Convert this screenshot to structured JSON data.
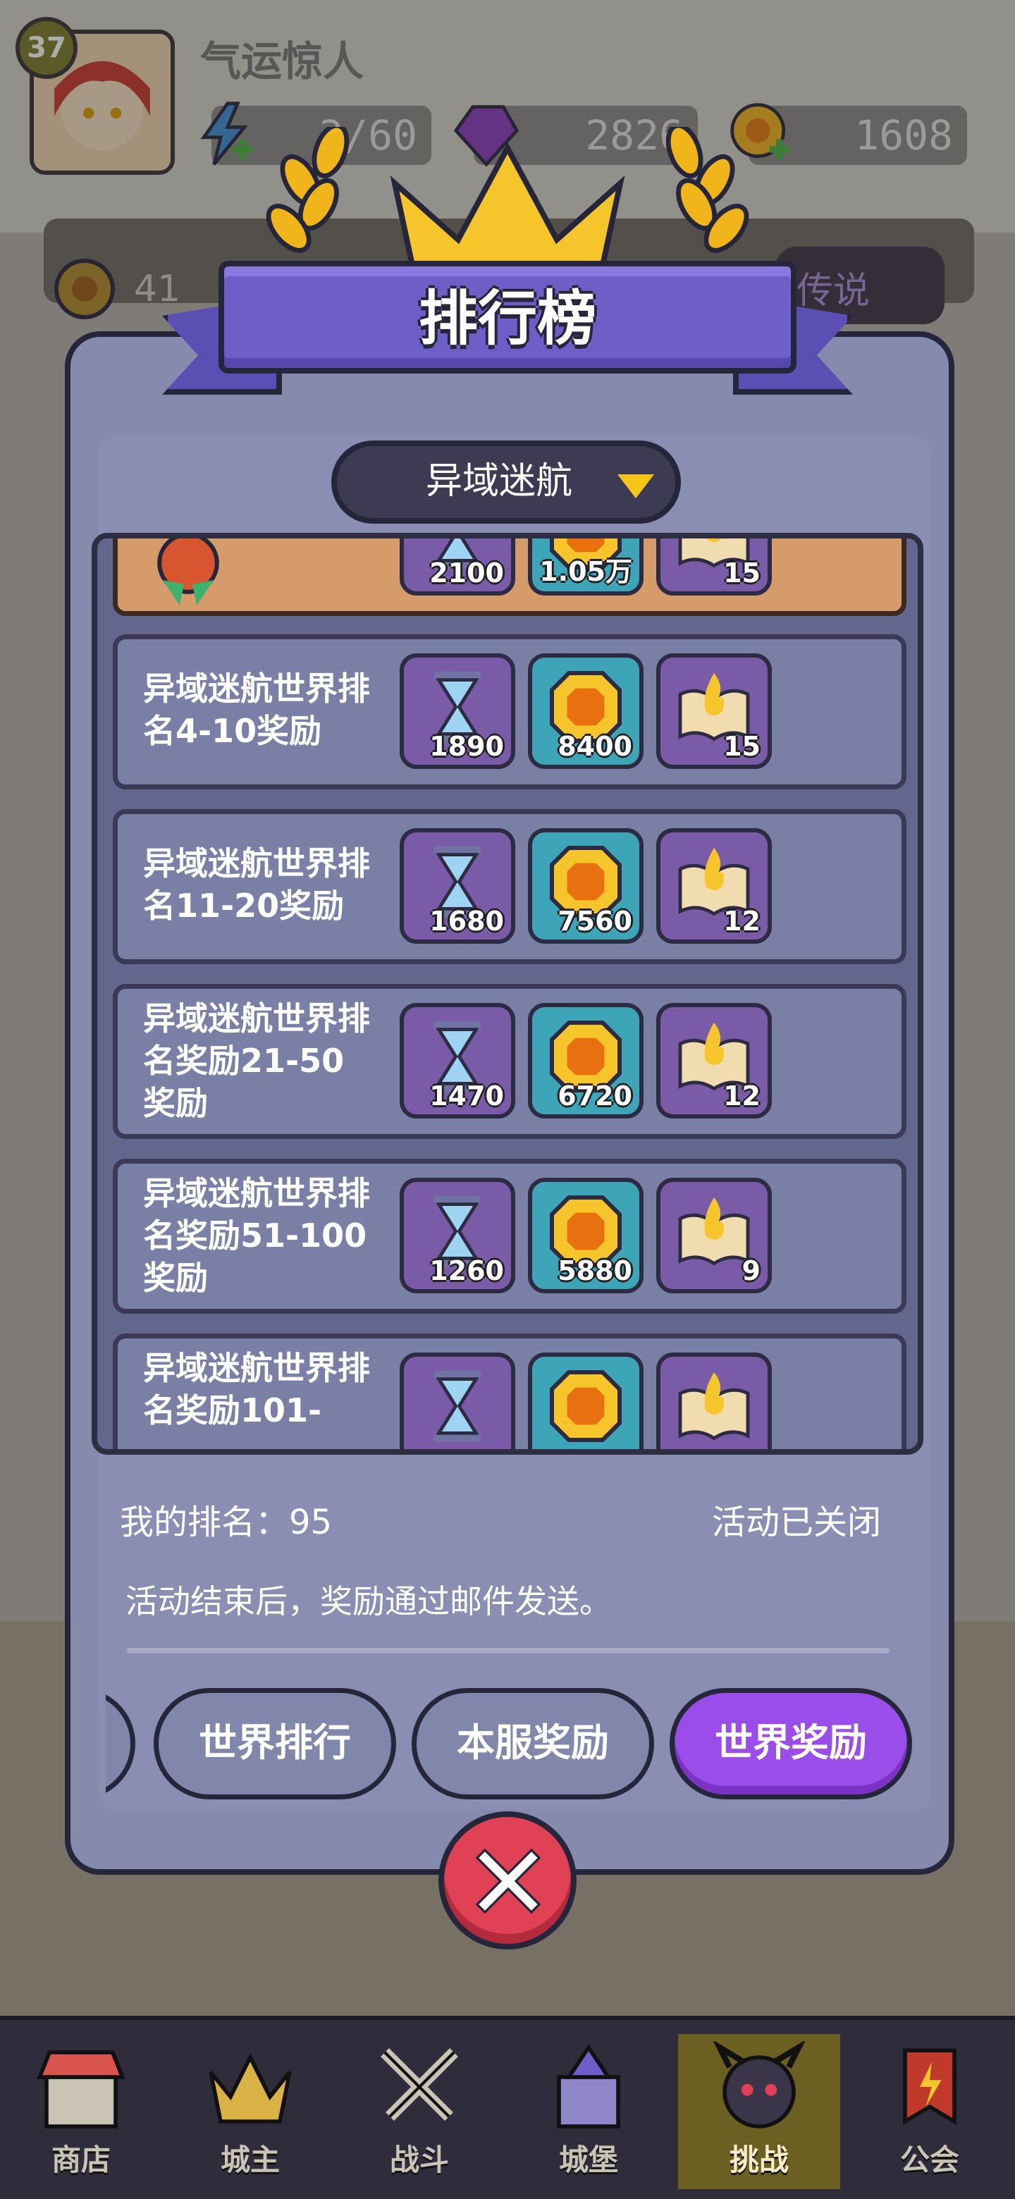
{
  "player": {
    "level": "37",
    "name": "气运惊人"
  },
  "resources": {
    "energy": "3/60",
    "gems": "2826",
    "coins": "1608"
  },
  "background": {
    "partial_amount": "41",
    "side_dropdown": "传说"
  },
  "panel": {
    "title": "排行榜",
    "selected_event": "异域迷航"
  },
  "reward_rows": [
    {
      "label": "",
      "items": [
        "2100",
        "1.05万",
        "15"
      ]
    },
    {
      "label": "异域迷航世界排名4-10奖励",
      "items": [
        "1890",
        "8400",
        "15"
      ]
    },
    {
      "label": "异域迷航世界排名11-20奖励",
      "items": [
        "1680",
        "7560",
        "12"
      ]
    },
    {
      "label": "异域迷航世界排名奖励21-50奖励",
      "items": [
        "1470",
        "6720",
        "12"
      ]
    },
    {
      "label": "异域迷航世界排名奖励51-100奖励",
      "items": [
        "1260",
        "5880",
        "9"
      ]
    },
    {
      "label": "异域迷航世界排名奖励101-",
      "items": [
        "",
        "",
        ""
      ]
    }
  ],
  "info": {
    "my_rank_label": "我的排名：95",
    "status": "活动已关闭",
    "note": "活动结束后，奖励通过邮件发送。"
  },
  "tabs": [
    "世界排行",
    "本服奖励",
    "世界奖励"
  ],
  "active_tab": "世界奖励",
  "nav": [
    "商店",
    "城主",
    "战斗",
    "城堡",
    "挑战",
    "公会"
  ],
  "active_nav": "挑战",
  "colors": {
    "panel": "#868bae",
    "active_tab": "#9a4de8",
    "close": "#e04155",
    "banner": "#6e5ec7"
  }
}
